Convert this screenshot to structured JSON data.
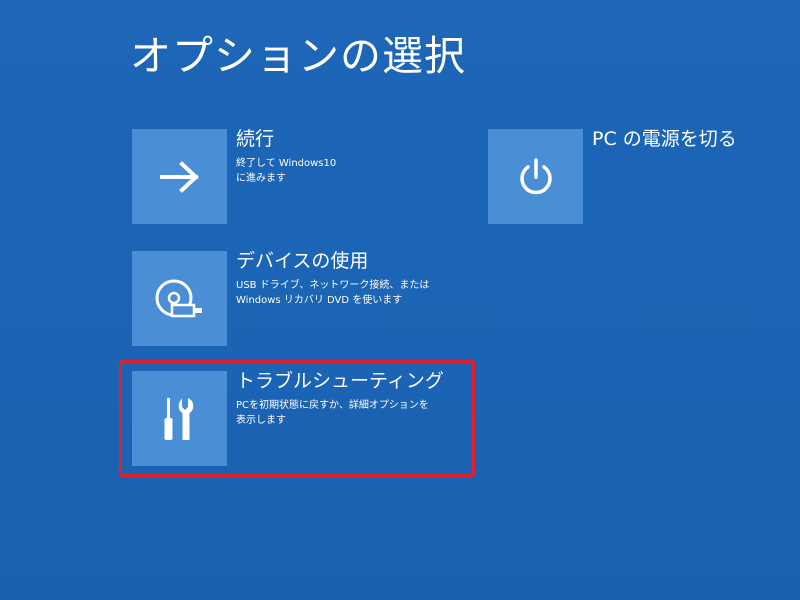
{
  "page": {
    "title": "オプションの選択"
  },
  "options": {
    "continue": {
      "title": "続行",
      "desc_line1": "終了して Windows10",
      "desc_line2": "に進みます",
      "icon": "arrow-right-icon"
    },
    "device": {
      "title": "デバイスの使用",
      "desc_line1": "USB ドライブ、ネットワーク接続、または",
      "desc_line2": "Windows リカバリ DVD を使います",
      "icon": "disc-usb-icon"
    },
    "troubleshoot": {
      "title": "トラブルシューティング",
      "desc_line1": "PCを初期状態に戻すか、詳細オプションを",
      "desc_line2": "表示します",
      "icon": "tools-icon"
    },
    "power": {
      "title": "PC の電源を切る",
      "icon": "power-icon"
    }
  },
  "colors": {
    "background": "#1b63b4",
    "tile": "#4a8fd6",
    "highlight": "#e0202e",
    "text": "#ffffff"
  }
}
